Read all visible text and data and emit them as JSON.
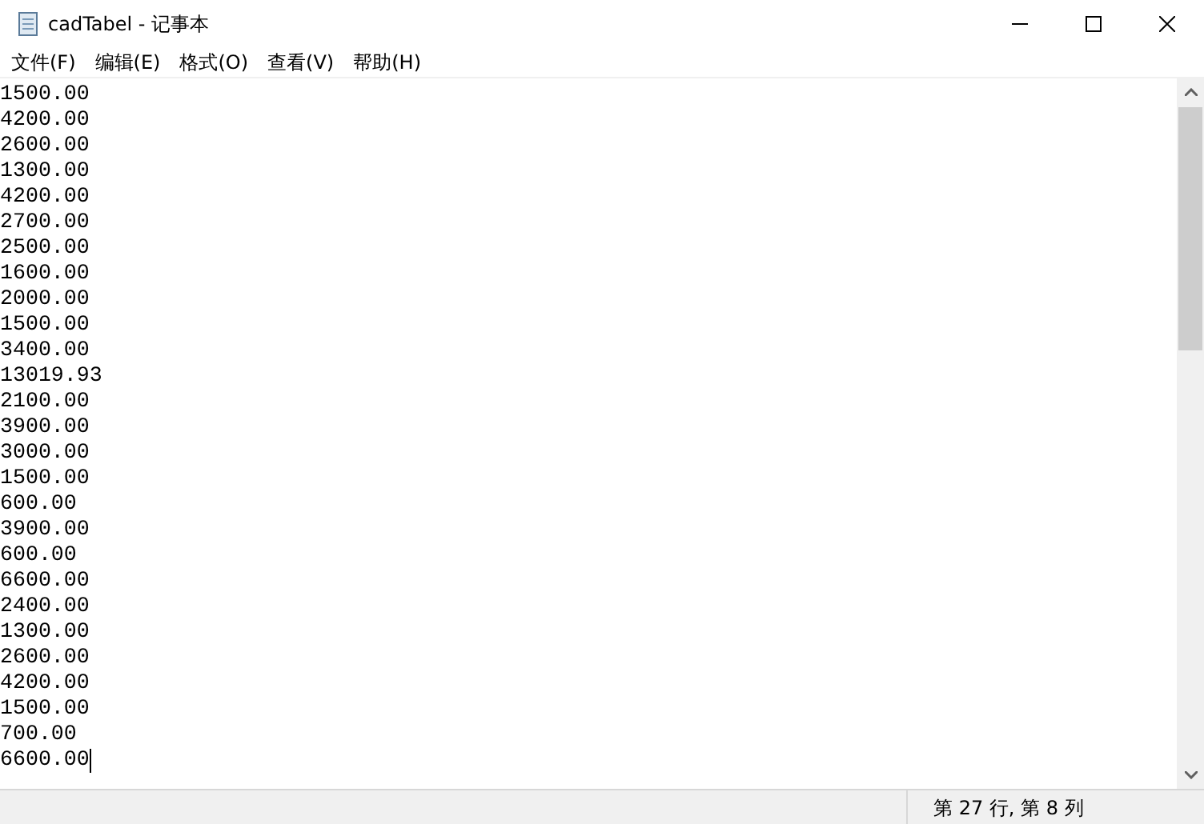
{
  "window": {
    "title": "cadTabel - 记事本"
  },
  "menu": [
    "文件(F)",
    "编辑(E)",
    "格式(O)",
    "查看(V)",
    "帮助(H)"
  ],
  "editor": {
    "lines": [
      "1500.00",
      "4200.00",
      "2600.00",
      "1300.00",
      "4200.00",
      "2700.00",
      "2500.00",
      "1600.00",
      "2000.00",
      "1500.00",
      "3400.00",
      "13019.93",
      "2100.00",
      "3900.00",
      "3000.00",
      "1500.00",
      "600.00",
      "3900.00",
      "600.00",
      "6600.00",
      "2400.00",
      "1300.00",
      "2600.00",
      "4200.00",
      "1500.00",
      "700.00",
      "6600.00"
    ]
  },
  "status_bar": {
    "position": "第 27 行, 第 8 列"
  }
}
